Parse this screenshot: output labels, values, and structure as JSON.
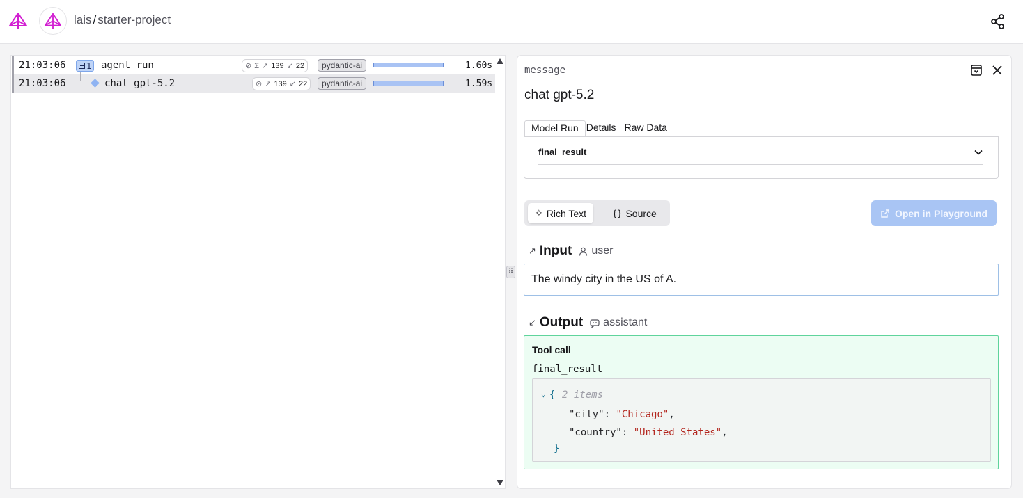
{
  "header": {
    "org": "lais",
    "separator": "/",
    "project": "starter-project",
    "logo_icon": "pyramid-logo-icon",
    "share_icon": "share-icon",
    "brand_color": "#d21fd2"
  },
  "trace": {
    "rows": [
      {
        "time": "21:03:06",
        "child_count": "1",
        "name": "agent run",
        "tokens_in": "139",
        "tokens_out": "22",
        "tag": "pydantic-ai",
        "duration": "1.60s"
      },
      {
        "time": "21:03:06",
        "name": "chat gpt-5.2",
        "tokens_in": "139",
        "tokens_out": "22",
        "tag": "pydantic-ai",
        "duration": "1.59s"
      }
    ]
  },
  "detail": {
    "kind": "message",
    "title": "chat gpt-5.2",
    "tabs": [
      "Model Run",
      "Details",
      "Raw Data"
    ],
    "active_tab": "Model Run",
    "tool_select": "final_result",
    "view_modes": [
      "Rich Text",
      "Source"
    ],
    "active_view": "Rich Text",
    "playground_label": "Open in Playground",
    "input": {
      "heading": "Input",
      "role": "user",
      "text": "The windy city in the US of A."
    },
    "output": {
      "heading": "Output",
      "role": "assistant",
      "tool_call_label": "Tool call",
      "tool_name": "final_result",
      "json": {
        "open_brace": "{",
        "summary": "2 items",
        "entries": [
          {
            "key": "\"city\"",
            "value": "\"Chicago\""
          },
          {
            "key": "\"country\"",
            "value": "\"United States\""
          }
        ],
        "close_brace": "}"
      }
    }
  },
  "colors": {
    "accent": "#a9c5f4",
    "output_border": "#5fd49c",
    "output_bg": "#ecfdf3",
    "json_string": "#b3261e"
  }
}
